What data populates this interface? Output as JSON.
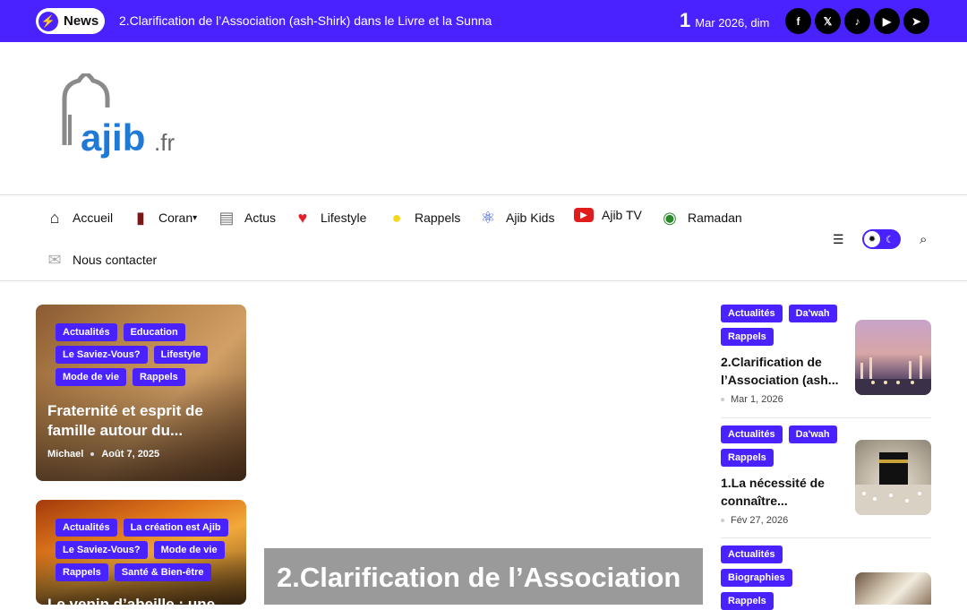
{
  "topbar": {
    "news_label": "News",
    "ticker": "2.Clarification de l’Association (ash-Shirk) dans le Livre et la Sunna",
    "date_day": "1",
    "date_rest": "Mar 2026, dim",
    "socials": [
      {
        "name": "facebook-icon",
        "glyph": "f"
      },
      {
        "name": "x-icon",
        "glyph": "𝕏"
      },
      {
        "name": "tiktok-icon",
        "glyph": "♪"
      },
      {
        "name": "youtube-icon",
        "glyph": "▶"
      },
      {
        "name": "telegram-icon",
        "glyph": "➤"
      }
    ]
  },
  "logo": {
    "text": "ajib",
    "suffix": ".fr"
  },
  "nav": {
    "items": [
      {
        "label": "Accueil",
        "icon": "home-icon",
        "glyph": "⌂"
      },
      {
        "label": "Coran",
        "icon": "book-icon",
        "glyph": "▮"
      },
      {
        "label": "Actus",
        "icon": "document-icon",
        "glyph": "▤"
      },
      {
        "label": "Lifestyle",
        "icon": "heart-icon",
        "glyph": "♥"
      },
      {
        "label": "Rappels",
        "icon": "lightbulb-icon",
        "glyph": "●"
      },
      {
        "label": "Ajib Kids",
        "icon": "atom-icon",
        "glyph": "⚛"
      },
      {
        "label": "Ajib TV",
        "icon": "tv-icon",
        "glyph": "▶"
      },
      {
        "label": "Ramadan",
        "icon": "compass-icon",
        "glyph": "◉"
      },
      {
        "label": "Nous contacter",
        "icon": "envelope-icon",
        "glyph": "✉"
      }
    ],
    "coran_caret": "▾"
  },
  "cards": [
    {
      "tags": [
        "Actualités",
        "Education",
        "Le Saviez-Vous?",
        "Lifestyle",
        "Mode de vie",
        "Rappels"
      ],
      "title": "Fraternité et esprit de famille autour du...",
      "author": "Michael",
      "date": "Août 7, 2025"
    },
    {
      "tags": [
        "Actualités",
        "La création est Ajib",
        "Le Saviez-Vous?",
        "Mode de vie",
        "Rappels",
        "Santé & Bien-être"
      ],
      "title": "Le venin d’abeille : une..."
    }
  ],
  "hero": {
    "title": "2.Clarification de l’Association"
  },
  "right_list": [
    {
      "tags": [
        "Actualités",
        "Da'wah",
        "Rappels"
      ],
      "title": "2.Clarification de l’Association (ash...",
      "date": "Mar 1, 2026"
    },
    {
      "tags": [
        "Actualités",
        "Da'wah",
        "Rappels"
      ],
      "title": "1.La nécessité de connaître...",
      "date": "Fév 27, 2026"
    },
    {
      "tags": [
        "Actualités",
        "Biographies",
        "Rappels"
      ]
    }
  ],
  "colors": {
    "accent": "#4a22ff"
  }
}
